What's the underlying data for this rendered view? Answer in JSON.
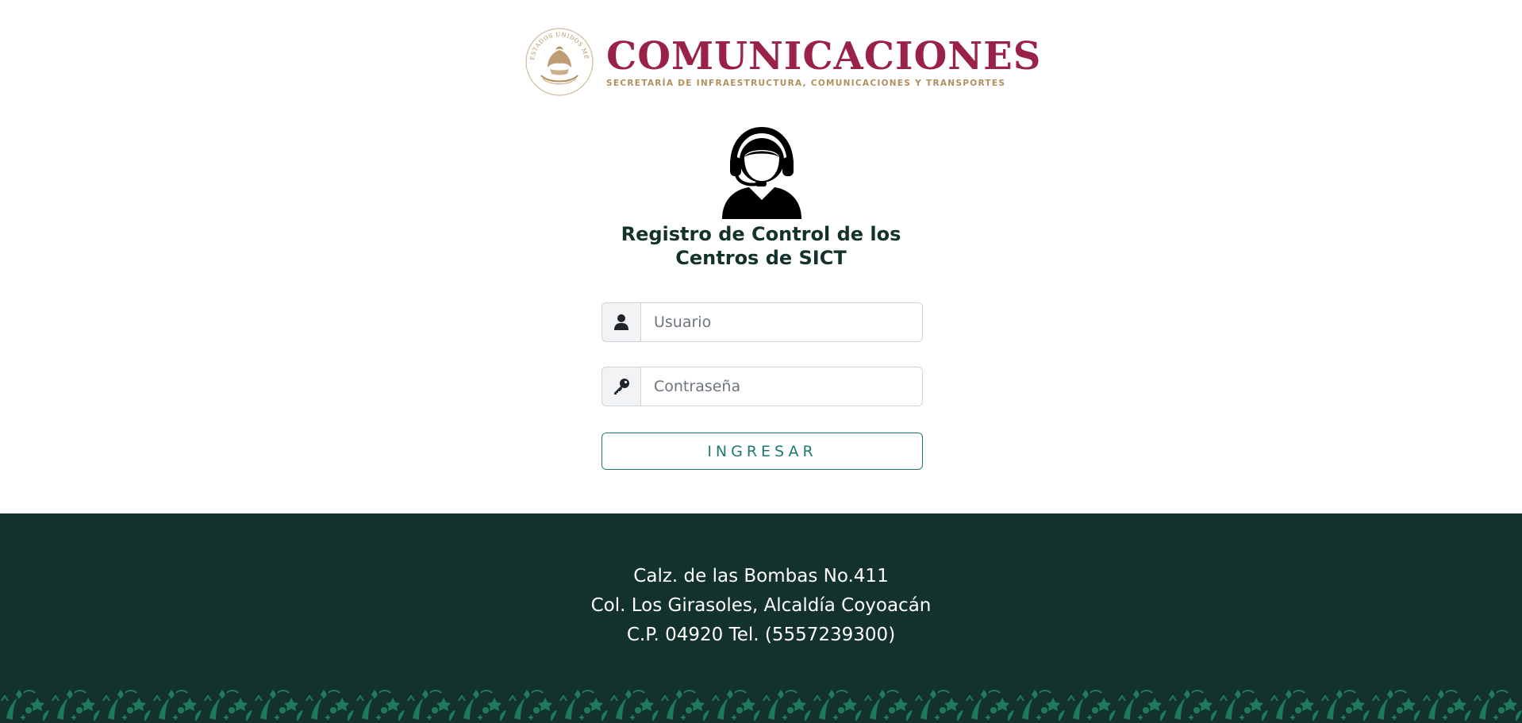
{
  "header": {
    "title": "COMUNICACIONES",
    "subtitle": "SECRETARÍA DE INFRAESTRUCTURA, COMUNICACIONES Y TRANSPORTES",
    "seal_text": "ESTADOS UNIDOS MEXICANOS"
  },
  "login": {
    "title": "Registro de Control de los Centros de SICT",
    "username_placeholder": "Usuario",
    "password_placeholder": "Contraseña",
    "submit_label": "INGRESAR"
  },
  "footer": {
    "address_line_1": "Calz. de las Bombas No.411",
    "address_line_2": "Col. Los Girasoles, Alcaldía Coyoacán",
    "address_line_3": "C.P. 04920 Tel. (5557239300)"
  },
  "colors": {
    "brand_wine": "#9b2247",
    "brand_gold": "#b38e5d",
    "footer_green": "#13322b",
    "accent_teal": "#1f7a6e",
    "pattern_green": "#1f7a5c"
  },
  "icons": {
    "seal": "national-seal-icon",
    "agent": "support-agent-icon",
    "user": "user-icon",
    "key": "key-icon"
  }
}
